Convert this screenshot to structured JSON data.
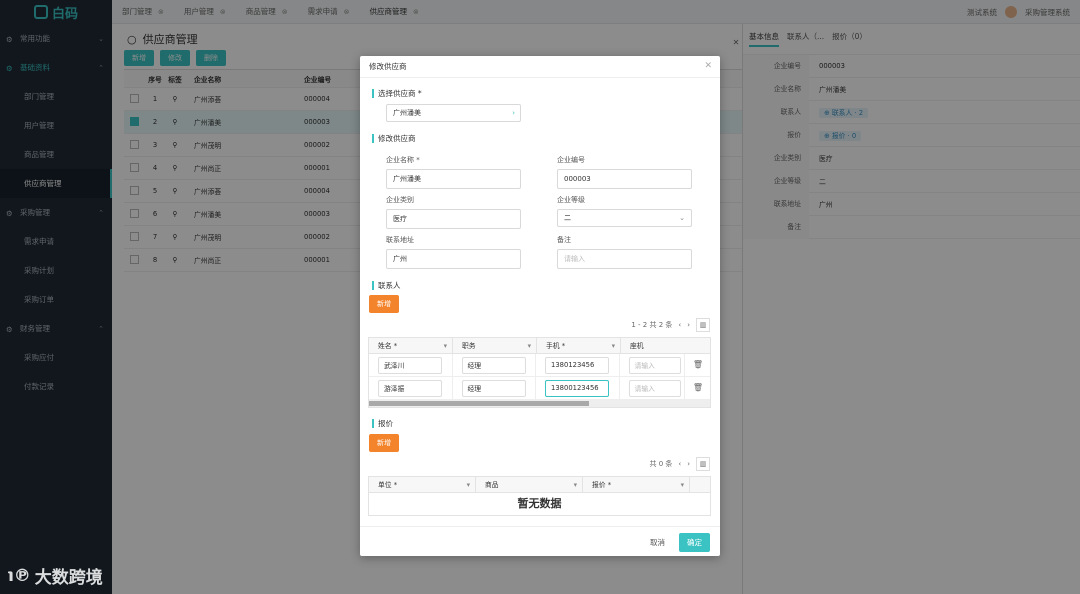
{
  "app": {
    "logo": "白码"
  },
  "sidebar": {
    "items": [
      {
        "type": "group",
        "label": "常用功能",
        "arrow": "⌄",
        "active": false
      },
      {
        "type": "group",
        "label": "基础资料",
        "arrow": "⌃",
        "active": true
      },
      {
        "type": "item",
        "label": "部门管理"
      },
      {
        "type": "item",
        "label": "用户管理"
      },
      {
        "type": "item",
        "label": "商品管理"
      },
      {
        "type": "item",
        "label": "供应商管理",
        "selected": true
      },
      {
        "type": "group",
        "label": "采购管理",
        "arrow": "⌃"
      },
      {
        "type": "item",
        "label": "需求申请"
      },
      {
        "type": "item",
        "label": "采购计划"
      },
      {
        "type": "item",
        "label": "采购订单"
      },
      {
        "type": "group",
        "label": "财务管理",
        "arrow": "⌃"
      },
      {
        "type": "item",
        "label": "采购应付"
      },
      {
        "type": "item",
        "label": "付款记录"
      }
    ]
  },
  "tabs": [
    "部门管理",
    "用户管理",
    "商品管理",
    "需求申请",
    "供应商管理"
  ],
  "topright": {
    "system": "测试系统",
    "user": "采购管理系统"
  },
  "page": {
    "title": "供应商管理",
    "buttons": [
      "新增",
      "修改",
      "删除"
    ]
  },
  "grid": {
    "headers": [
      "序号",
      "标签",
      "企业名称",
      "企业编号"
    ],
    "rows": [
      {
        "no": "1",
        "name": "广州添荟",
        "code": "000004",
        "checked": false
      },
      {
        "no": "2",
        "name": "广州潘美",
        "code": "000003",
        "checked": true
      },
      {
        "no": "3",
        "name": "广州茂明",
        "code": "000002",
        "checked": false
      },
      {
        "no": "4",
        "name": "广州尚正",
        "code": "000001",
        "checked": false
      },
      {
        "no": "5",
        "name": "广州添荟",
        "code": "000004",
        "checked": false
      },
      {
        "no": "6",
        "name": "广州潘美",
        "code": "000003",
        "checked": false
      },
      {
        "no": "7",
        "name": "广州茂明",
        "code": "000002",
        "checked": false
      },
      {
        "no": "8",
        "name": "广州尚正",
        "code": "000001",
        "checked": false
      }
    ]
  },
  "detail": {
    "tabs": [
      "基本信息",
      "联系人（...",
      "报价（0）"
    ],
    "rows": [
      {
        "k": "企业编号",
        "v": "000003"
      },
      {
        "k": "企业名称",
        "v": "广州潘美"
      },
      {
        "k": "联系人",
        "v": "⊕ 联系人 · 2",
        "pill": true
      },
      {
        "k": "报价",
        "v": "⊕ 报价 · 0",
        "pill": true
      },
      {
        "k": "企业类别",
        "v": "医疗"
      },
      {
        "k": "企业等级",
        "v": "二"
      },
      {
        "k": "联系地址",
        "v": "广州"
      },
      {
        "k": "备注",
        "v": ""
      }
    ]
  },
  "modal": {
    "title": "修改供应商",
    "select_label": "选择供应商 *",
    "select_value": "广州潘美",
    "edit_label": "修改供应商",
    "f_name_label": "企业名称 *",
    "f_name": "广州潘美",
    "f_code_label": "企业编号",
    "f_code": "000003",
    "f_cat_label": "企业类别",
    "f_cat": "医疗",
    "f_level_label": "企业等级",
    "f_level": "二",
    "f_addr_label": "联系地址",
    "f_addr": "广州",
    "f_note_label": "备注",
    "f_note_ph": "请输入",
    "contacts_label": "联系人",
    "add": "新增",
    "contacts_pager": "1 - 2  共 2 条",
    "contact_headers": [
      "姓名 *",
      "职务",
      "手机 *",
      "座机"
    ],
    "contacts": [
      {
        "name": "武泽川",
        "role": "经理",
        "mobile": "1380123456",
        "phone_ph": "请输入"
      },
      {
        "name": "游泽振",
        "role": "经理",
        "mobile": "13800123456",
        "phone_ph": "请输入"
      }
    ],
    "quote_label": "报价",
    "quote_pager": "共 0 条",
    "quote_headers": [
      "单位 *",
      "商品",
      "报价 *"
    ],
    "empty": "暂无数据",
    "cancel": "取消",
    "ok": "确定"
  },
  "watermark": "大数跨境"
}
